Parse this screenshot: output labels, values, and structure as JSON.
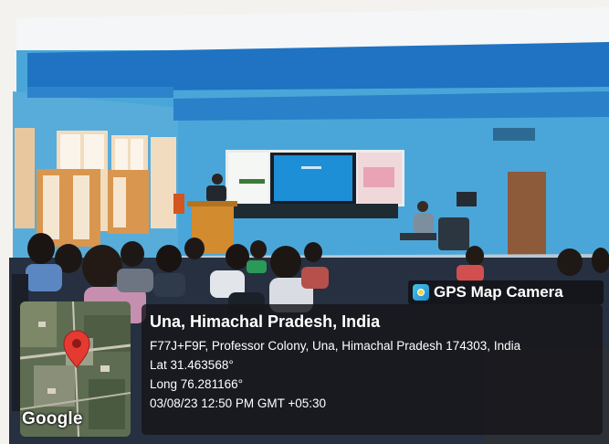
{
  "watermark": {
    "brand_label": "GPS Map Camera",
    "brand_icon": "gps-map-camera-icon",
    "map_provider": "Google",
    "pin_icon": "map-pin-icon",
    "location_title": "Una, Himachal Pradesh, India",
    "address": "F77J+F9F, Professor Colony, Una, Himachal Pradesh 174303, India",
    "latitude": "Lat 31.463568°",
    "longitude": "Long 76.281166°",
    "datetime": "03/08/23 12:50 PM GMT +05:30"
  },
  "scene": {
    "wall_color": "#4aa6d8",
    "beam_color": "#1f73c2",
    "ceiling_color": "#f4f6f8",
    "screen_color": "#1c8fd6"
  }
}
